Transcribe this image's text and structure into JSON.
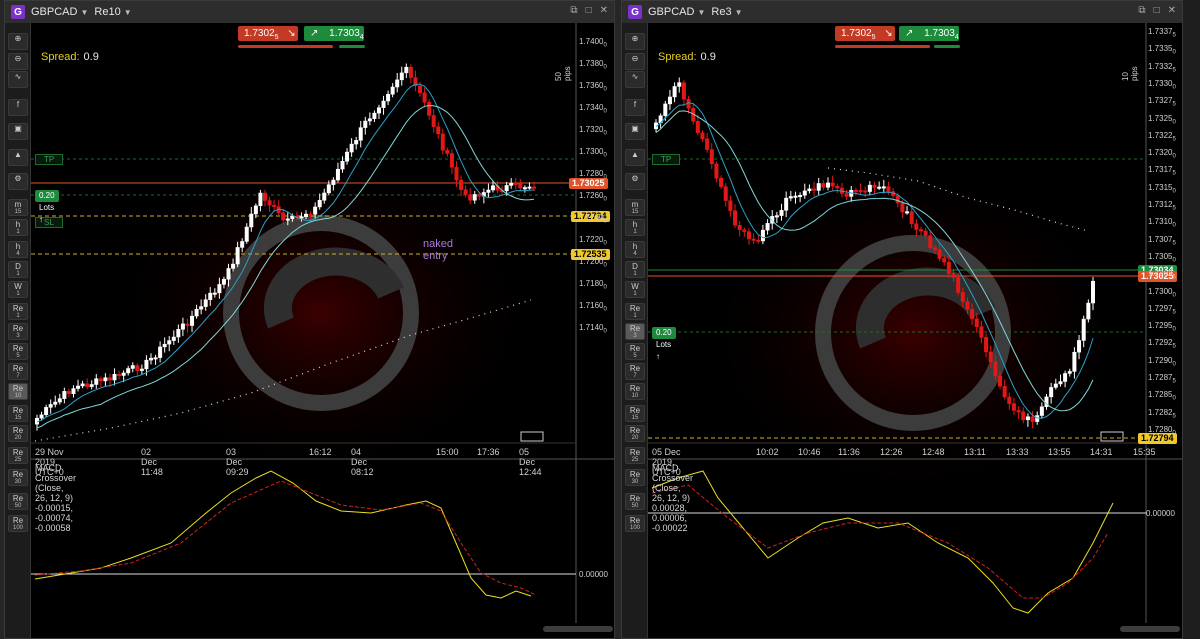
{
  "panels": [
    {
      "symbol": "GBPCAD",
      "timeframe": "Re10",
      "spread_label": "Spread:",
      "spread_value": "0.9",
      "sell_price": "1.7302",
      "sell_sup": "5",
      "buy_price": "1.7303",
      "buy_sup": "4",
      "pips_label": "50 pips",
      "price_labels": [
        "1.7400",
        "1.7380",
        "1.7360",
        "1.7340",
        "1.7320",
        "1.7300",
        "1.7280",
        "1.7260",
        "1.7240",
        "1.7220",
        "1.7200",
        "1.7180",
        "1.7160",
        "1.7140"
      ],
      "price_label_sups": [
        "0",
        "0",
        "0",
        "0",
        "0",
        "0",
        "0",
        "0",
        "0",
        "0",
        "0",
        "0",
        "0",
        "0"
      ],
      "current_price_tag": "1.73025",
      "sl_price_tag": "1.72794",
      "entry_price_tag": "1.72535",
      "tp_label": "TP",
      "sl_label": "SL",
      "lots_label": "0.20 Lots",
      "annotation": "naked entry",
      "time_labels": [
        "29 Nov 2019, UTC+0",
        "02 Dec 11:48",
        "03 Dec 09:29",
        "16:12",
        "04 Dec 08:12",
        "15:00",
        "17:36",
        "05 Dec 12:44"
      ],
      "macd_label": "MACD Crossover (Close, 26, 12, 9) -0.00015, -0.00074, -0.00058",
      "macd_zero_label": "0.00000"
    },
    {
      "symbol": "GBPCAD",
      "timeframe": "Re3",
      "spread_label": "Spread:",
      "spread_value": "0.9",
      "sell_price": "1.7302",
      "sell_sup": "5",
      "buy_price": "1.7303",
      "buy_sup": "4",
      "pips_label": "10 pips",
      "price_labels": [
        "1.7337",
        "1.7335",
        "1.7332",
        "1.7330",
        "1.7327",
        "1.7325",
        "1.7322",
        "1.7320",
        "1.7317",
        "1.7315",
        "1.7312",
        "1.7310",
        "1.7307",
        "1.7305",
        "1.7302",
        "1.7300",
        "1.7297",
        "1.7295",
        "1.7292",
        "1.7290",
        "1.7287",
        "1.7285",
        "1.7282",
        "1.7280"
      ],
      "price_label_sups": [
        "5",
        "0",
        "5",
        "0",
        "5",
        "0",
        "5",
        "0",
        "5",
        "0",
        "5",
        "0",
        "5",
        "0",
        "5",
        "0",
        "5",
        "0",
        "5",
        "0",
        "5",
        "0",
        "5",
        "0"
      ],
      "green_price_tag": "1.73034",
      "current_price_tag": "1.73025",
      "sl_price_tag": "1.72794",
      "tp_label": "TP",
      "lots_label": "0.20 Lots",
      "time_labels": [
        "05 Dec 2019, UTC+0",
        "10:02",
        "10:46",
        "11:36",
        "12:26",
        "12:48",
        "13:11",
        "13:33",
        "13:55",
        "14:31",
        "15:35"
      ],
      "macd_label": "MACD Crossover (Close, 26, 12, 9) 0.00028, 0.00006, -0.00022",
      "macd_zero_label": "0.00000"
    }
  ],
  "toolbar_items": [
    {
      "icon": "zoom-in-icon",
      "label": "⊕",
      "sub": ""
    },
    {
      "icon": "zoom-out-icon",
      "label": "⊖",
      "sub": ""
    },
    {
      "icon": "indicator-icon",
      "label": "∿",
      "sub": ""
    },
    {
      "icon": "f-icon",
      "label": "f",
      "sub": ""
    },
    {
      "icon": "robot-icon",
      "label": "▣",
      "sub": ""
    },
    {
      "icon": "drawing-icon",
      "label": "▲",
      "sub": ""
    },
    {
      "icon": "settings-icon",
      "label": "⚙",
      "sub": ""
    },
    {
      "icon": "timeframe-m15-icon",
      "label": "m",
      "sub": "15"
    },
    {
      "icon": "timeframe-h1-icon",
      "label": "h",
      "sub": "1"
    },
    {
      "icon": "timeframe-h4-icon",
      "label": "h",
      "sub": "4"
    },
    {
      "icon": "timeframe-d1-icon",
      "label": "D",
      "sub": "1"
    },
    {
      "icon": "timeframe-w1-icon",
      "label": "W",
      "sub": "1"
    },
    {
      "icon": "renko-re1-icon",
      "label": "Re",
      "sub": "1"
    },
    {
      "icon": "renko-re3-icon",
      "label": "Re",
      "sub": "3"
    },
    {
      "icon": "renko-re5-icon",
      "label": "Re",
      "sub": "5"
    },
    {
      "icon": "renko-re7-icon",
      "label": "Re",
      "sub": "7"
    },
    {
      "icon": "renko-re10-icon",
      "label": "Re",
      "sub": "10"
    },
    {
      "icon": "renko-re15-icon",
      "label": "Re",
      "sub": "15"
    },
    {
      "icon": "renko-re20-icon",
      "label": "Re",
      "sub": "20"
    },
    {
      "icon": "renko-re25-icon",
      "label": "Re",
      "sub": "25"
    },
    {
      "icon": "renko-re30-icon",
      "label": "Re",
      "sub": "30"
    },
    {
      "icon": "renko-re50-icon",
      "label": "Re",
      "sub": "50"
    },
    {
      "icon": "renko-re100-icon",
      "label": "Re",
      "sub": "100"
    }
  ],
  "colors": {
    "bull": "#ffffff",
    "bear": "#e01818",
    "sma_fast": "#2aa0c8",
    "sma_slow": "#7fd8d8",
    "macd": "#e8e020",
    "signal": "#d02020",
    "tp_line": "#1e6a2c",
    "entry_line": "#c8b028",
    "price_line": "#e0542c"
  }
}
